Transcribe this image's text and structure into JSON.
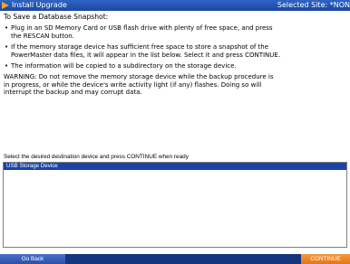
{
  "window": {
    "title": "Install Upgrade",
    "selected_site": "Selected Site: *NON",
    "icon": "powermaster-app-icon"
  },
  "instructions": {
    "heading": "To Save a Database Snapshot:",
    "bullets": [
      "Plug in an SD Memory Card or USB flash drive with plenty of free space, and press the RESCAN button.",
      "If the memory storage device has sufficient free space to store a snapshot of the PowerMaster data files, it will appear in the list below. Select it and press CONTINUE.",
      "The information will be copied to a subdirectory on the storage device."
    ],
    "warning": "WARNING: Do not remove the memory storage device while the backup procedure is in progress, or while the device's write activity light (if any) flashes. Doing so will interrupt the backup and may corrupt data."
  },
  "destination": {
    "prompt": "Select the desired destination device and press CONTINUE when ready",
    "devices": [
      "USB Storage Device"
    ],
    "selected_index": 0
  },
  "footer": {
    "back_label": "Go Back",
    "continue_label": "CONTINUE"
  },
  "colors": {
    "titlebar": "#1c47a2",
    "selection": "#1b44a8",
    "footer": "#14367f",
    "continue_button": "#e27719"
  }
}
